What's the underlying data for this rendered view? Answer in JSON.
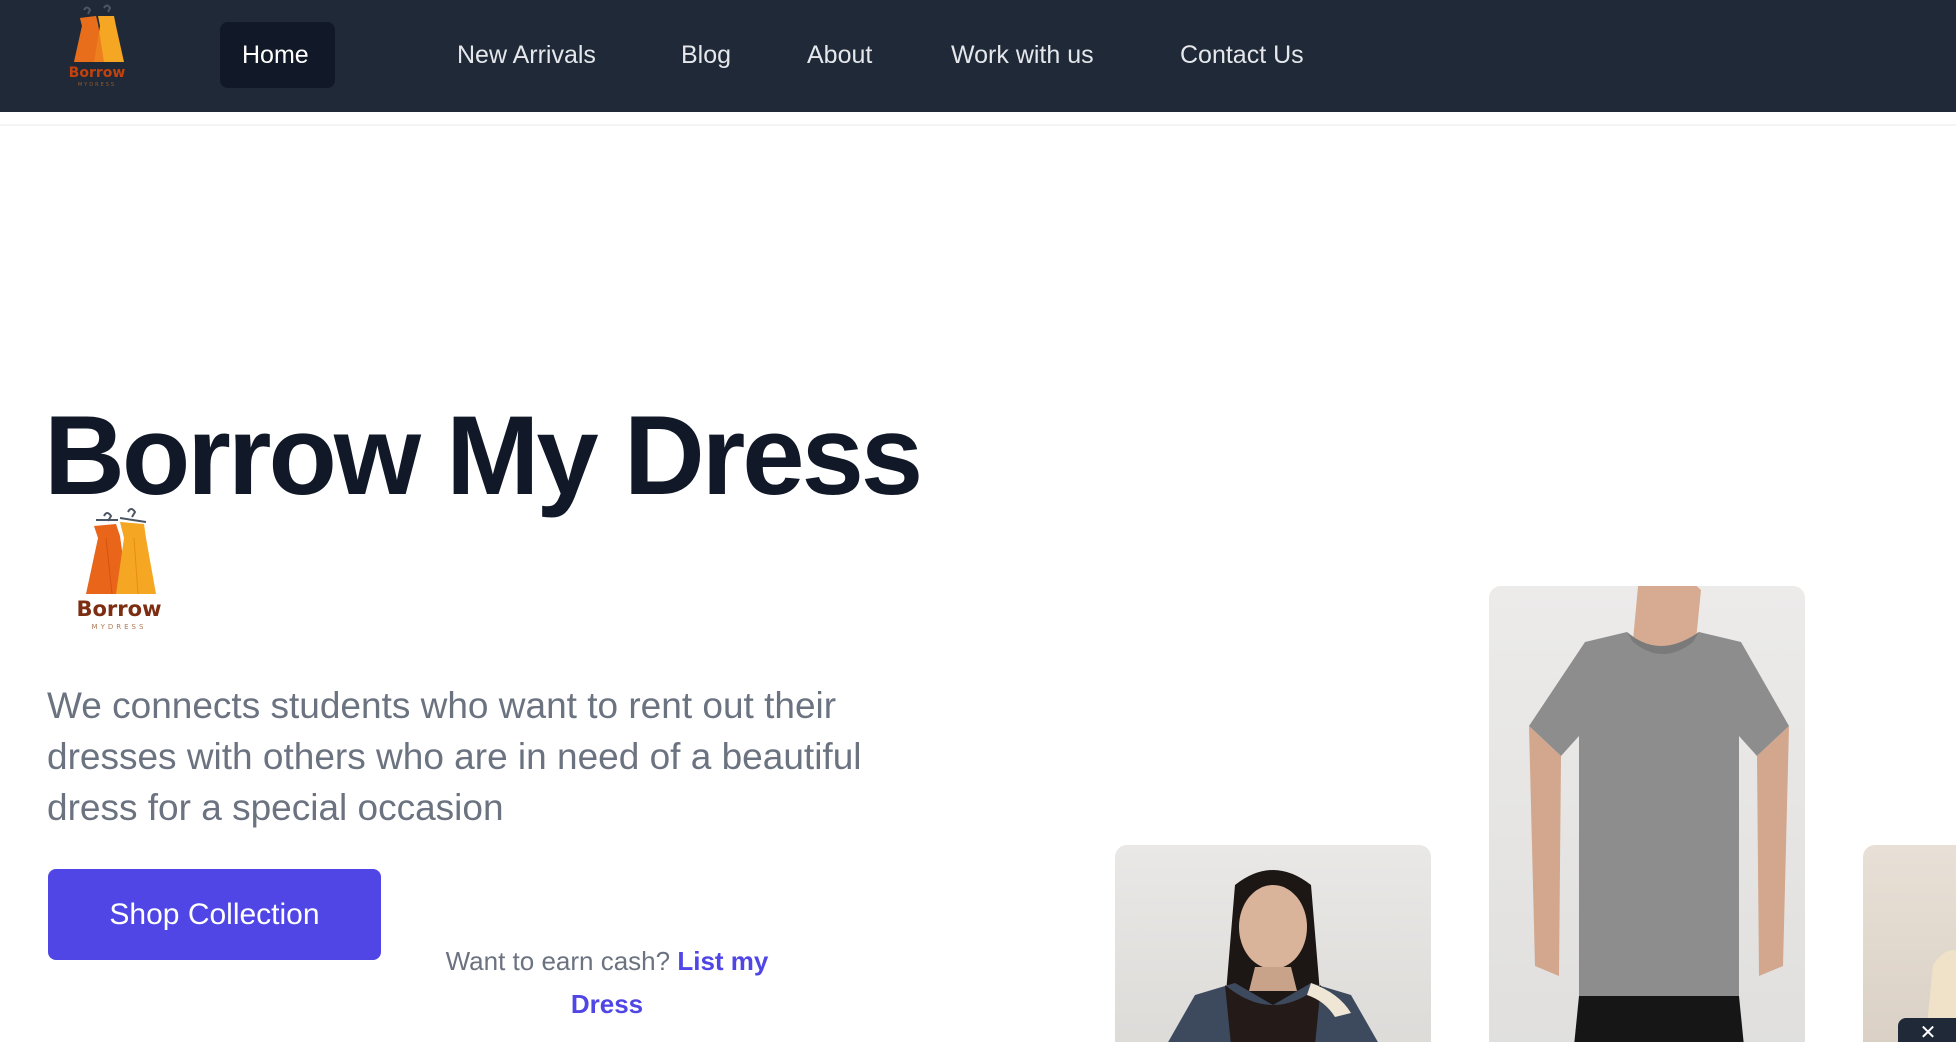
{
  "nav": {
    "logo": {
      "word": "Borrow",
      "sub": "MYDRESS"
    },
    "items": [
      {
        "label": "Home"
      },
      {
        "label": "New Arrivals"
      },
      {
        "label": "Blog"
      },
      {
        "label": "About"
      },
      {
        "label": "Work with us"
      },
      {
        "label": "Contact Us"
      }
    ],
    "active_index": 0
  },
  "hero": {
    "title": "Borrow My Dress",
    "logo": {
      "word": "Borrow",
      "sub": "MYDRESS"
    },
    "description": "We connects students who want to rent out their dresses with others who are in need of a beautiful dress for a special occasion",
    "cta_label": "Shop Collection",
    "earn_prefix": "Want to earn cash?",
    "earn_link": "List my Dress"
  },
  "photos": [
    {
      "name": "woman-denim-jacket"
    },
    {
      "name": "man-gray-tshirt"
    },
    {
      "name": "partial-photo"
    }
  ],
  "colors": {
    "nav_bg": "#1f2937",
    "accent": "#4f46e5",
    "title": "#111827",
    "body_text": "#6b7280"
  }
}
